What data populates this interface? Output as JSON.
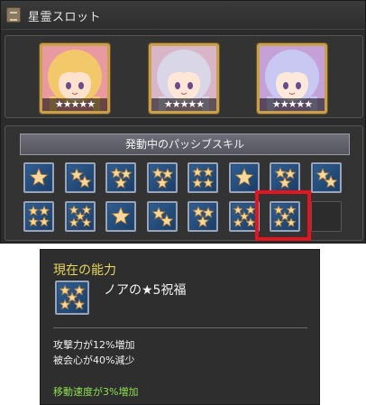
{
  "window": {
    "title": "星霊スロット",
    "title_icon": "book-icon"
  },
  "portraits": [
    {
      "name": "portrait-1",
      "stars": "★★★★★",
      "rarity": 5,
      "palette": {
        "hair": "#f2c86a",
        "skin": "#ffe2cc",
        "bg": "#e89aa0"
      }
    },
    {
      "name": "portrait-2",
      "stars": "★★★★★",
      "rarity": 5,
      "palette": {
        "hair": "#d9d6e8",
        "skin": "#ffe6d6",
        "bg": "#d8b6c8"
      }
    },
    {
      "name": "portrait-3",
      "stars": "★★★★★",
      "rarity": 5,
      "palette": {
        "hair": "#c9c8f2",
        "skin": "#fde8dc",
        "bg": "#c4a2d8"
      }
    }
  ],
  "skills": {
    "header": "発動中のパッシブスキル",
    "row1": [
      1,
      2,
      3,
      3,
      4,
      1,
      3,
      2
    ],
    "row2": [
      4,
      5,
      1,
      2,
      3,
      5,
      5,
      0
    ],
    "highlighted_index": 14
  },
  "tooltip": {
    "heading": "現在の能力",
    "skill_name": "ノアの★5祝福",
    "effects": [
      "攻撃力が12%増加",
      "被会心が40%減少"
    ],
    "extra_effect": "移動速度が3%増加",
    "colors": {
      "heading": "#e6d65a",
      "extra": "#8ddf4f"
    }
  }
}
